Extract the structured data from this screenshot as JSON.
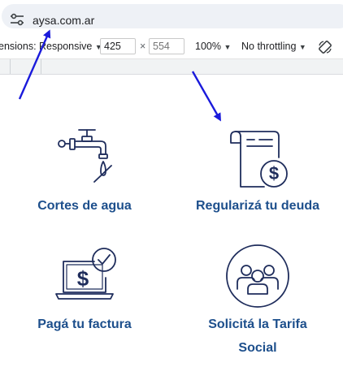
{
  "browser": {
    "url": "aysa.com.ar"
  },
  "devtools": {
    "dimensions_label": "ensions: Responsive",
    "width_value": "425",
    "height_value": "554",
    "times_symbol": "×",
    "zoom_label": "100%",
    "throttling_label": "No throttling"
  },
  "services": [
    {
      "label": "Cortes de agua",
      "icon": "water-tap-icon"
    },
    {
      "label": "Regularizá tu deuda",
      "icon": "document-dollar-icon"
    },
    {
      "label": "Pagá tu factura",
      "icon": "laptop-dollar-check-icon"
    },
    {
      "label_line1": "Solicitá la Tarifa",
      "label_line2": "Social",
      "icon": "people-group-icon"
    }
  ],
  "colors": {
    "brand_blue": "#1d4f8c",
    "icon_navy": "#1f2d5c",
    "annotation_arrow": "#1a1adb"
  }
}
